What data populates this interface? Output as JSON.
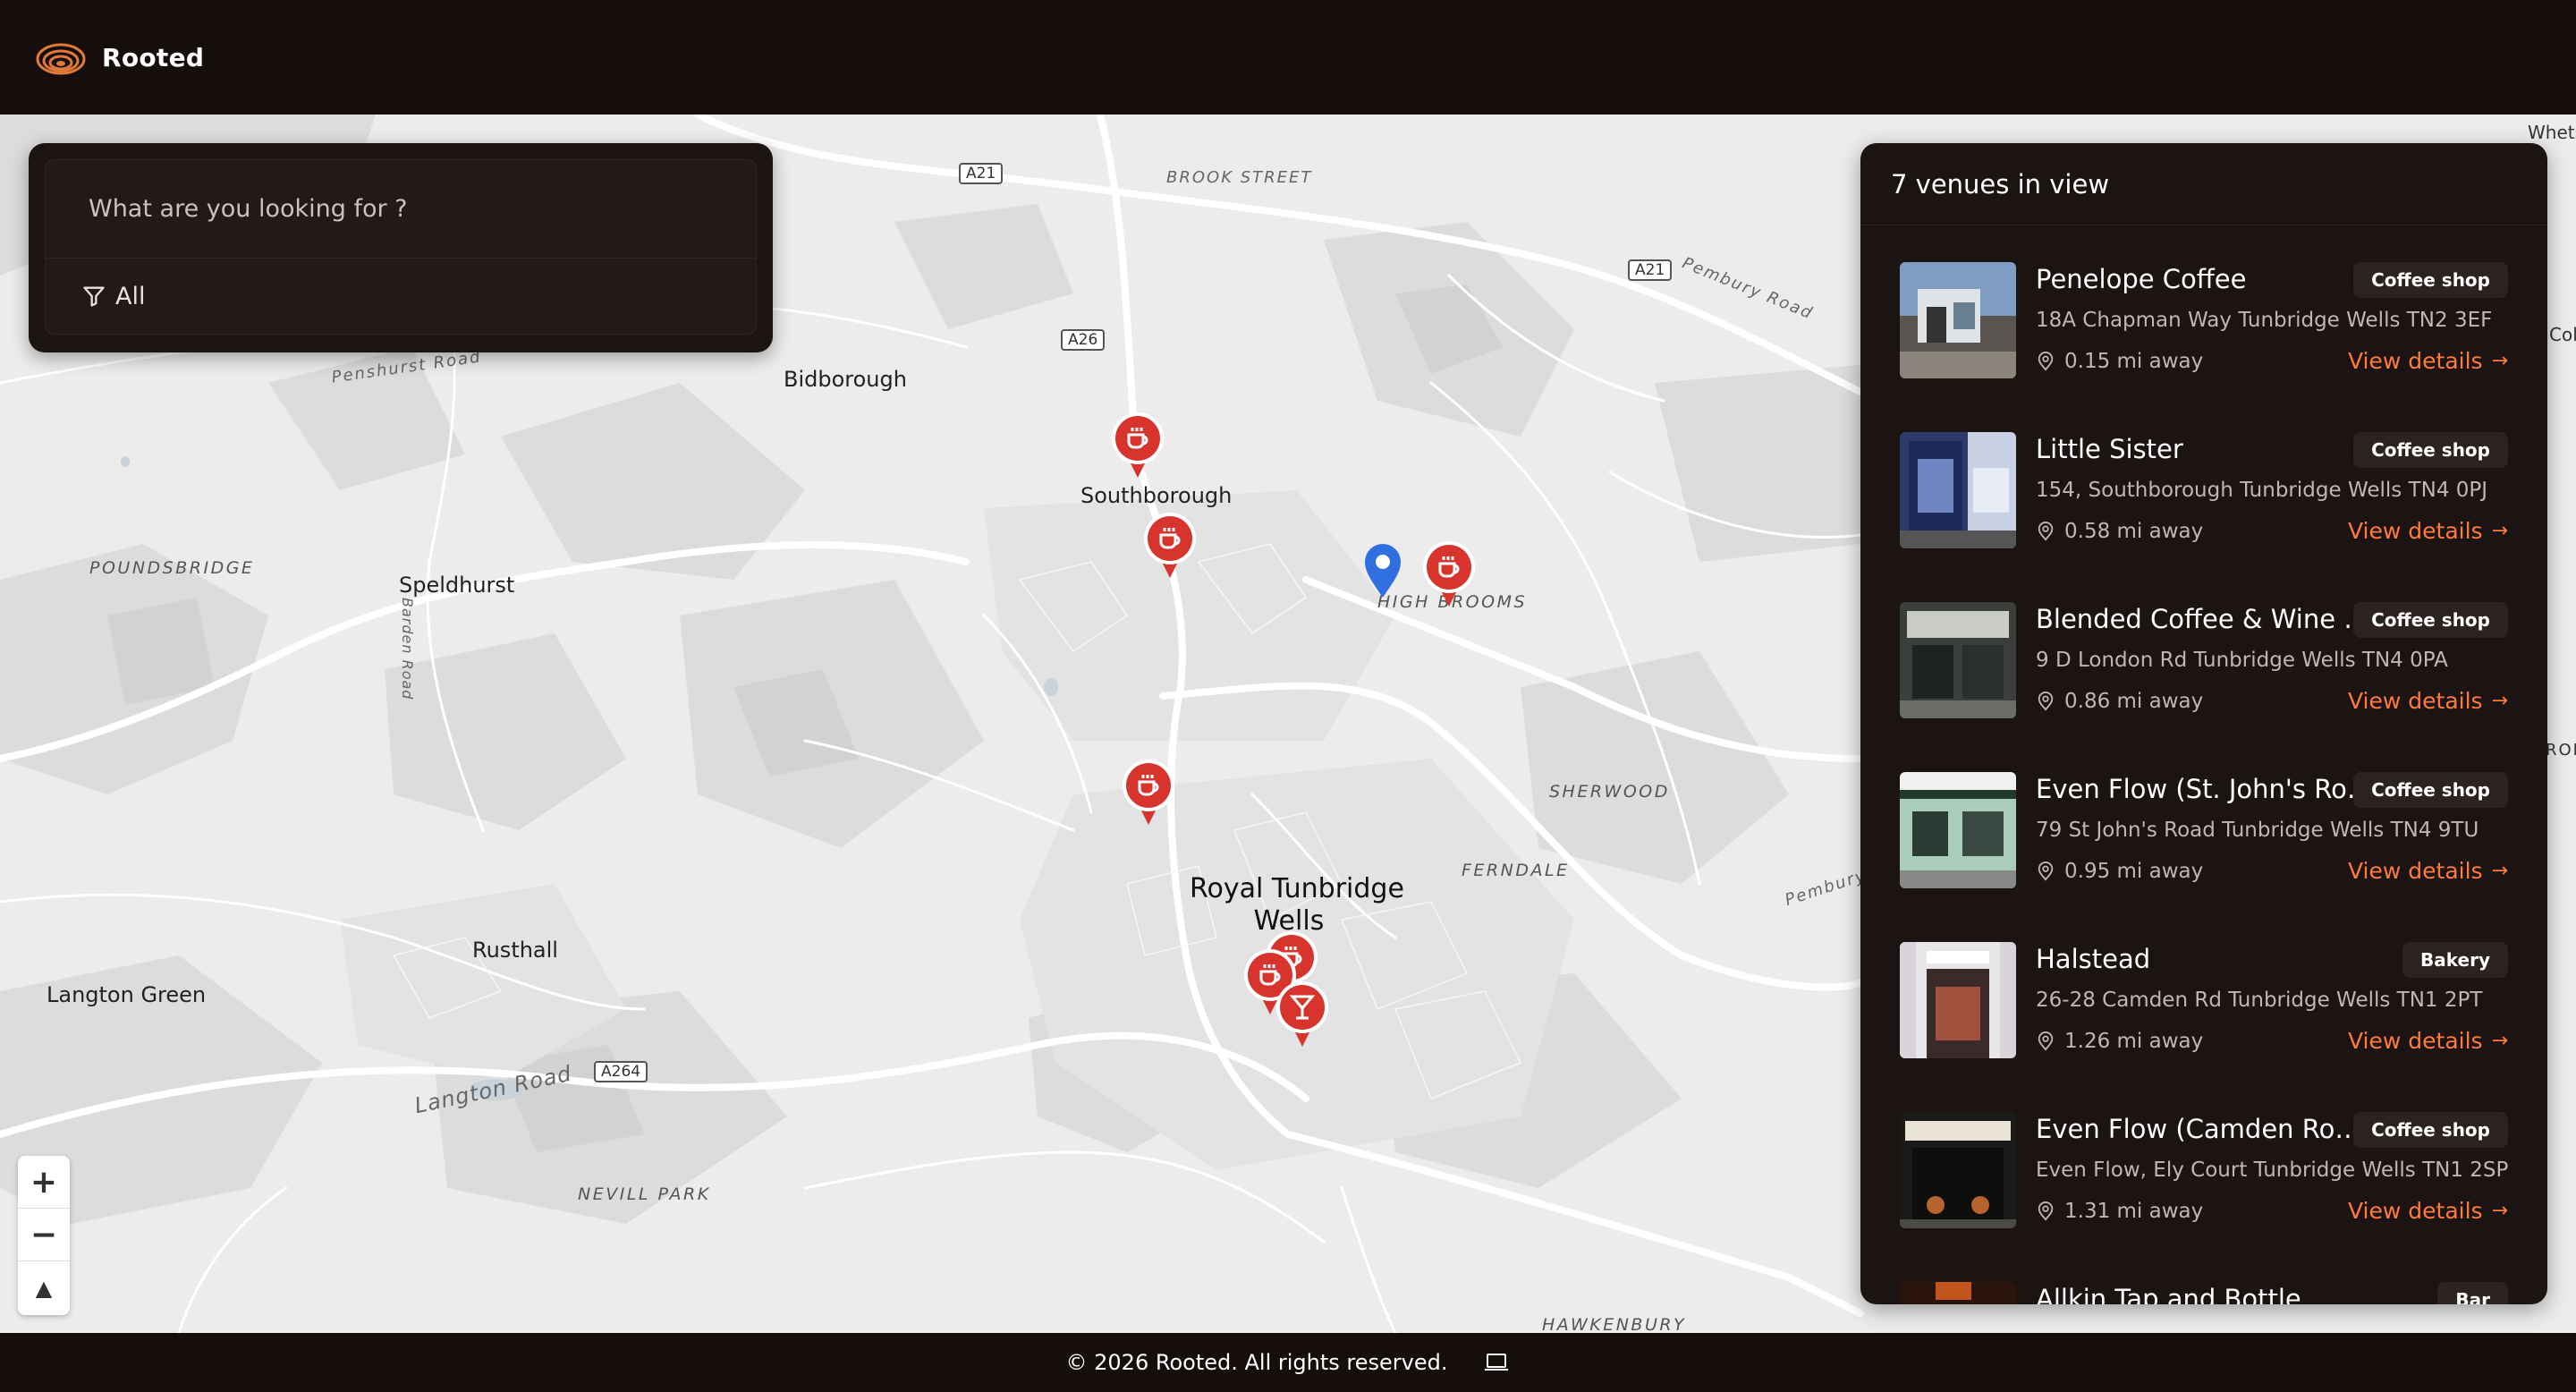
{
  "app": {
    "brand": "Rooted"
  },
  "search": {
    "placeholder": "What are you looking for ?",
    "filter_label": "All"
  },
  "map": {
    "labels": {
      "brook_street": "BROOK STREET",
      "pembury_road": "Pembury Road",
      "penshurst_road": "Penshurst Road",
      "bidborough": "Bidborough",
      "southborough": "Southborough",
      "barden_road": "Barden Road",
      "poundsbridge": "POUNDSBRIDGE",
      "speldhurst": "Speldhurst",
      "high_brooms": "HIGH BROOMS",
      "sherwood": "SHERWOOD",
      "ferndale": "FERNDALE",
      "royal_tunbridge": "Royal Tunbridge",
      "wells": "Wells",
      "rusthall": "Rusthall",
      "langton_green": "Langton Green",
      "langton_road": "Langton Road",
      "nevill_park": "NEVILL PARK",
      "hawkenbury": "HAWKENBURY",
      "pembury_edge": "Pembury",
      "whets": "Whets",
      "col": "Col",
      "rom": "ROM"
    },
    "shields": {
      "a21_top": "A21",
      "a21_right": "A21",
      "a26": "A26",
      "a264": "A264"
    },
    "zoom": {
      "in": "+",
      "out": "−",
      "compass": "▲"
    }
  },
  "venues": {
    "header": "7 venues in view",
    "link_label": "View details",
    "items": [
      {
        "name": "Penelope Coffee",
        "tag": "Coffee shop",
        "address": "18A Chapman Way Tunbridge Wells TN2 3EF",
        "distance": "0.15 mi away"
      },
      {
        "name": "Little Sister",
        "tag": "Coffee shop",
        "address": "154, Southborough Tunbridge Wells TN4 0PJ",
        "distance": "0.58 mi away"
      },
      {
        "name": "Blended Coffee & Wine Bar",
        "tag": "Coffee shop",
        "address": "9 D London Rd Tunbridge Wells TN4 0PA",
        "distance": "0.86 mi away"
      },
      {
        "name": "Even Flow (St. John's Roa...",
        "tag": "Coffee shop",
        "address": "79 St John's Road Tunbridge Wells TN4 9TU",
        "distance": "0.95 mi away"
      },
      {
        "name": "Halstead",
        "tag": "Bakery",
        "address": "26-28 Camden Rd Tunbridge Wells TN1 2PT",
        "distance": "1.26 mi away"
      },
      {
        "name": "Even Flow (Camden Road)",
        "tag": "Coffee shop",
        "address": "Even Flow, Ely Court Tunbridge Wells TN1 2SP",
        "distance": "1.31 mi away"
      },
      {
        "name": "Allkin Tap and Bottle",
        "tag": "Bar",
        "address": "",
        "distance": ""
      }
    ]
  },
  "footer": {
    "copyright": "© 2026 Rooted. All rights reserved."
  },
  "colors": {
    "accent": "#ff7a3d",
    "pin_red": "#d6342c",
    "user_pin": "#2f6fe0",
    "panel": "#1c1412",
    "background": "#150e0c"
  },
  "icons": [
    "rooted-logo-icon",
    "filter-icon",
    "coffee-cup-icon",
    "cocktail-icon",
    "location-pin-icon",
    "user-location-icon",
    "arrow-right-icon",
    "laptop-icon"
  ]
}
